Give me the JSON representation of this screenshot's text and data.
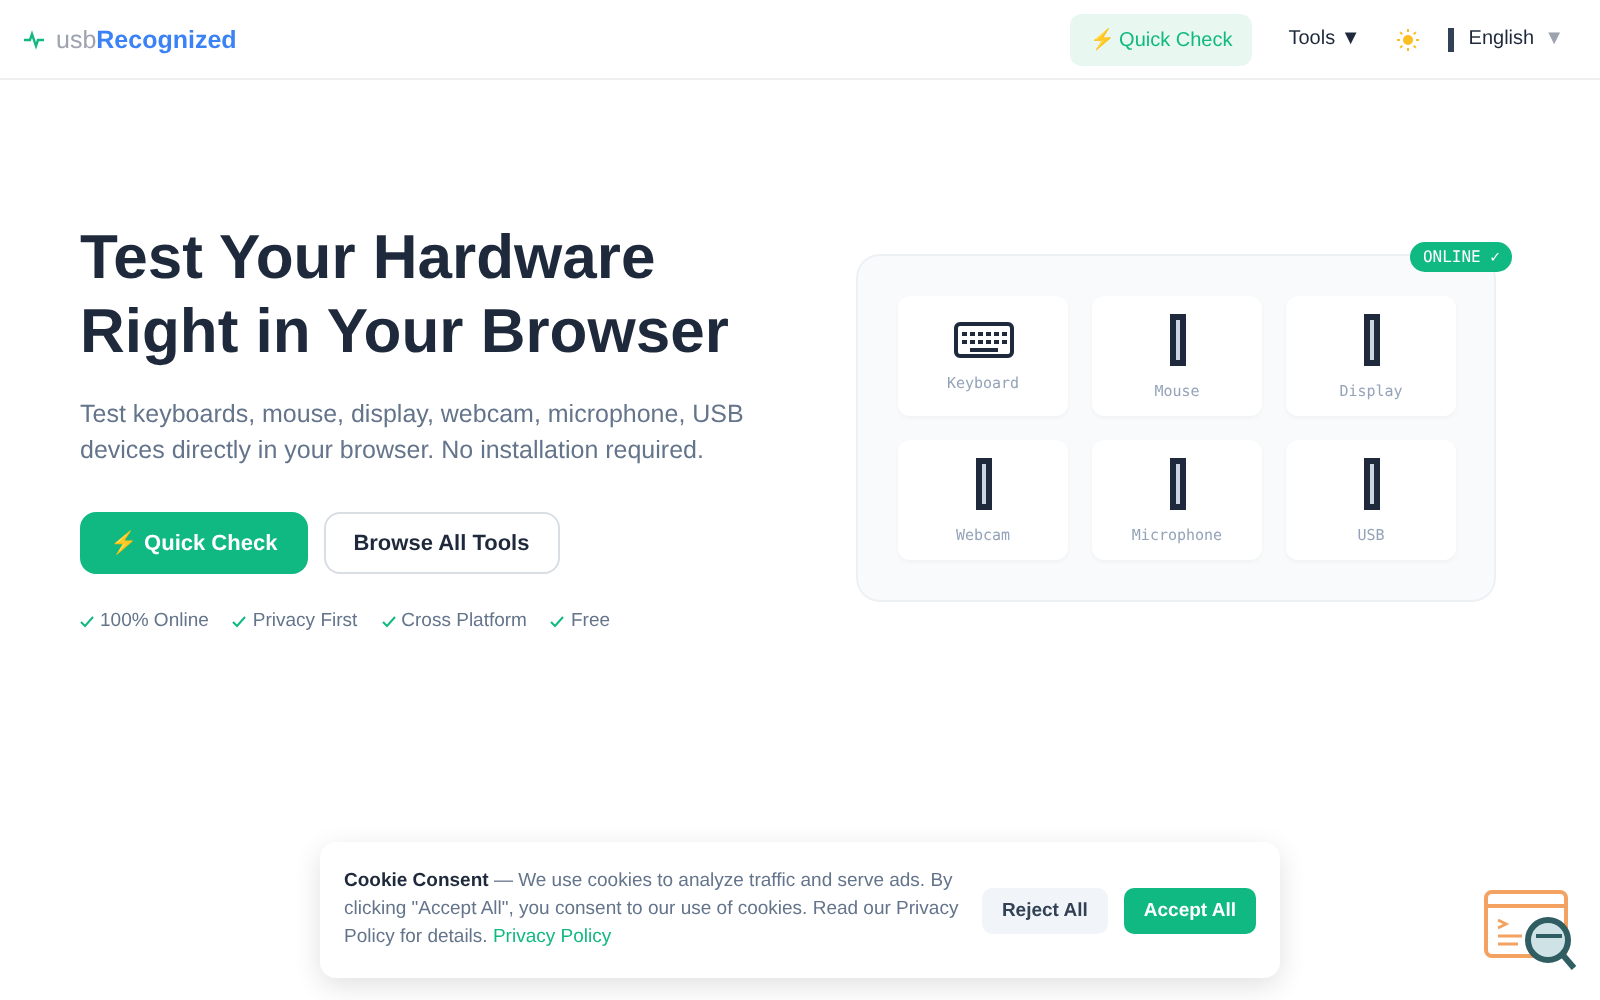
{
  "header": {
    "logo_prefix": "usb",
    "logo_brand": "Recognized",
    "quick_check": "⚡ Quick Check",
    "tools": "Tools ▼",
    "language": "English",
    "language_caret": "▼"
  },
  "hero": {
    "title_lines": [
      "Test Your Hardware",
      "Right in Your Browser"
    ],
    "description": "Test keyboards, mouse, display, webcam, microphone, USB devices directly in your browser. No installation required.",
    "primary_button": "⚡ Quick Check",
    "secondary_button": "Browse All Tools",
    "features": [
      "100% Online",
      "Privacy First",
      "Cross Platform",
      "Free"
    ]
  },
  "preview": {
    "badge": "ONLINE ✓",
    "tiles": [
      {
        "label": "Keyboard",
        "kind": "keyboard"
      },
      {
        "label": "Mouse",
        "kind": "glyph"
      },
      {
        "label": "Display",
        "kind": "glyph"
      },
      {
        "label": "Webcam",
        "kind": "glyph"
      },
      {
        "label": "Microphone",
        "kind": "glyph"
      },
      {
        "label": "USB",
        "kind": "glyph"
      }
    ]
  },
  "cookie": {
    "text": "**Cookie Consent** — We use cookies to analyze traffic and serve ads. By clicking \"Accept All\", you consent to our use of cookies. Read our Privacy Policy for details.",
    "link": "Privacy Policy",
    "reject": "Reject All",
    "accept": "Accept All"
  }
}
